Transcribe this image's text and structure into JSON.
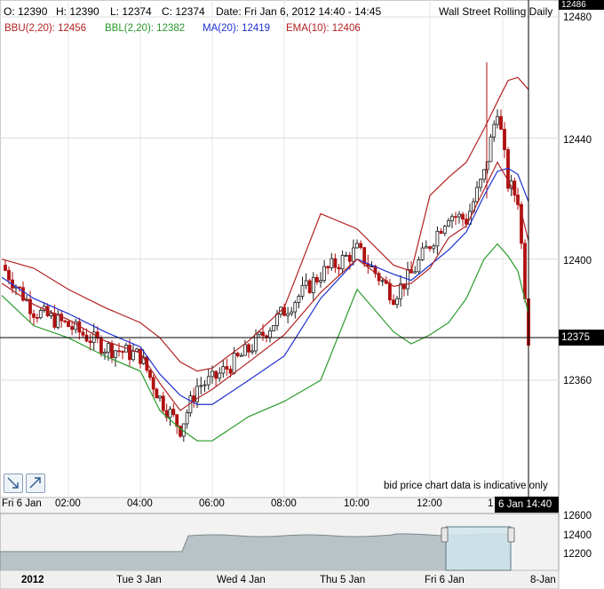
{
  "header": {
    "open": "O: 12390",
    "high": "H: 12390",
    "low": "L: 12374",
    "close": "C: 12374",
    "date": "Date: Fri Jan 6, 2012 14:40 - 14:45",
    "instrument": "Wall Street Rolling Daily"
  },
  "indicators": {
    "bbu": "BBU(2,20): 12456",
    "bbl": "BBL(2,20): 12382",
    "ma": "MA(20): 12419",
    "ema": "EMA(10): 12406"
  },
  "colors": {
    "bbu": "#b22222",
    "bbl": "#2a9a2a",
    "ma": "#1f2fd0",
    "ema": "#b22222",
    "candle_up": "#1a1a1a",
    "candle_down": "#b01010",
    "navigator_fill": "#b9c2c6",
    "navigator_window": "#cfe6ec"
  },
  "price_axis": {
    "labels": [
      "12480",
      "12440",
      "12400",
      "12360"
    ],
    "top_tag": "12486",
    "current_tag": "12375"
  },
  "time_axis": {
    "start_label": "Fri 6 Jan",
    "labels": [
      "02:00",
      "04:00",
      "06:00",
      "08:00",
      "10:00",
      "12:00",
      "1"
    ],
    "cursor_tag": "6 Jan 14:40"
  },
  "disclaimer": "bid price chart data is indicative only",
  "tools": {
    "zoom_out_icon": "arrow-down-right-icon",
    "zoom_in_icon": "arrow-up-right-icon"
  },
  "navigator": {
    "y_labels": [
      "12600",
      "12400",
      "12200"
    ],
    "x_labels": [
      "2012",
      "Tue 3 Jan",
      "Wed 4 Jan",
      "Thu 5 Jan",
      "Fri 6 Jan",
      "8-Jan"
    ]
  },
  "chart_data": {
    "type": "line",
    "title": "Wall Street Rolling Daily",
    "xlabel": "",
    "ylabel": "",
    "ylim": [
      12325,
      12486
    ],
    "grid": true,
    "x": [
      "00:00",
      "01:00",
      "02:00",
      "03:00",
      "04:00",
      "04:30",
      "05:00",
      "05:30",
      "06:00",
      "07:00",
      "08:00",
      "09:00",
      "10:00",
      "11:00",
      "11:30",
      "12:00",
      "12:30",
      "13:00",
      "13:30",
      "14:00",
      "14:15",
      "14:30",
      "14:40"
    ],
    "series": [
      {
        "name": "BBU(2,20)",
        "values": [
          12400,
          12397,
          12390,
          12384,
          12379,
          12374,
          12366,
          12363,
          12364,
          12373,
          12384,
          12415,
          12410,
          12398,
          12396,
          12421,
          12427,
          12432,
          12443,
          12452,
          12459,
          12460,
          12456
        ]
      },
      {
        "name": "BBL(2,20)",
        "values": [
          12388,
          12378,
          12374,
          12368,
          12363,
          12350,
          12344,
          12340,
          12340,
          12348,
          12353,
          12360,
          12390,
          12376,
          12372,
          12375,
          12379,
          12387,
          12400,
          12405,
          12401,
          12396,
          12382
        ]
      },
      {
        "name": "MA(20)",
        "values": [
          12394,
          12387,
          12382,
          12376,
          12371,
          12362,
          12355,
          12352,
          12352,
          12360,
          12368,
          12387,
          12400,
          12395,
          12393,
          12398,
          12403,
          12409,
          12421,
          12429,
          12430,
          12428,
          12419
        ]
      },
      {
        "name": "EMA(10)",
        "values": [
          12392,
          12385,
          12380,
          12373,
          12369,
          12359,
          12350,
          12354,
          12357,
          12366,
          12375,
          12389,
          12400,
          12391,
          12392,
          12397,
          12407,
          12411,
          12423,
          12432,
          12426,
          12420,
          12406
        ]
      },
      {
        "name": "Close",
        "values": [
          12398,
          12383,
          12378,
          12371,
          12368,
          12354,
          12344,
          12358,
          12360,
          12370,
          12383,
          12395,
          12403,
          12388,
          12395,
          12405,
          12415,
          12413,
          12428,
          12450,
          12425,
          12420,
          12374
        ]
      }
    ]
  }
}
